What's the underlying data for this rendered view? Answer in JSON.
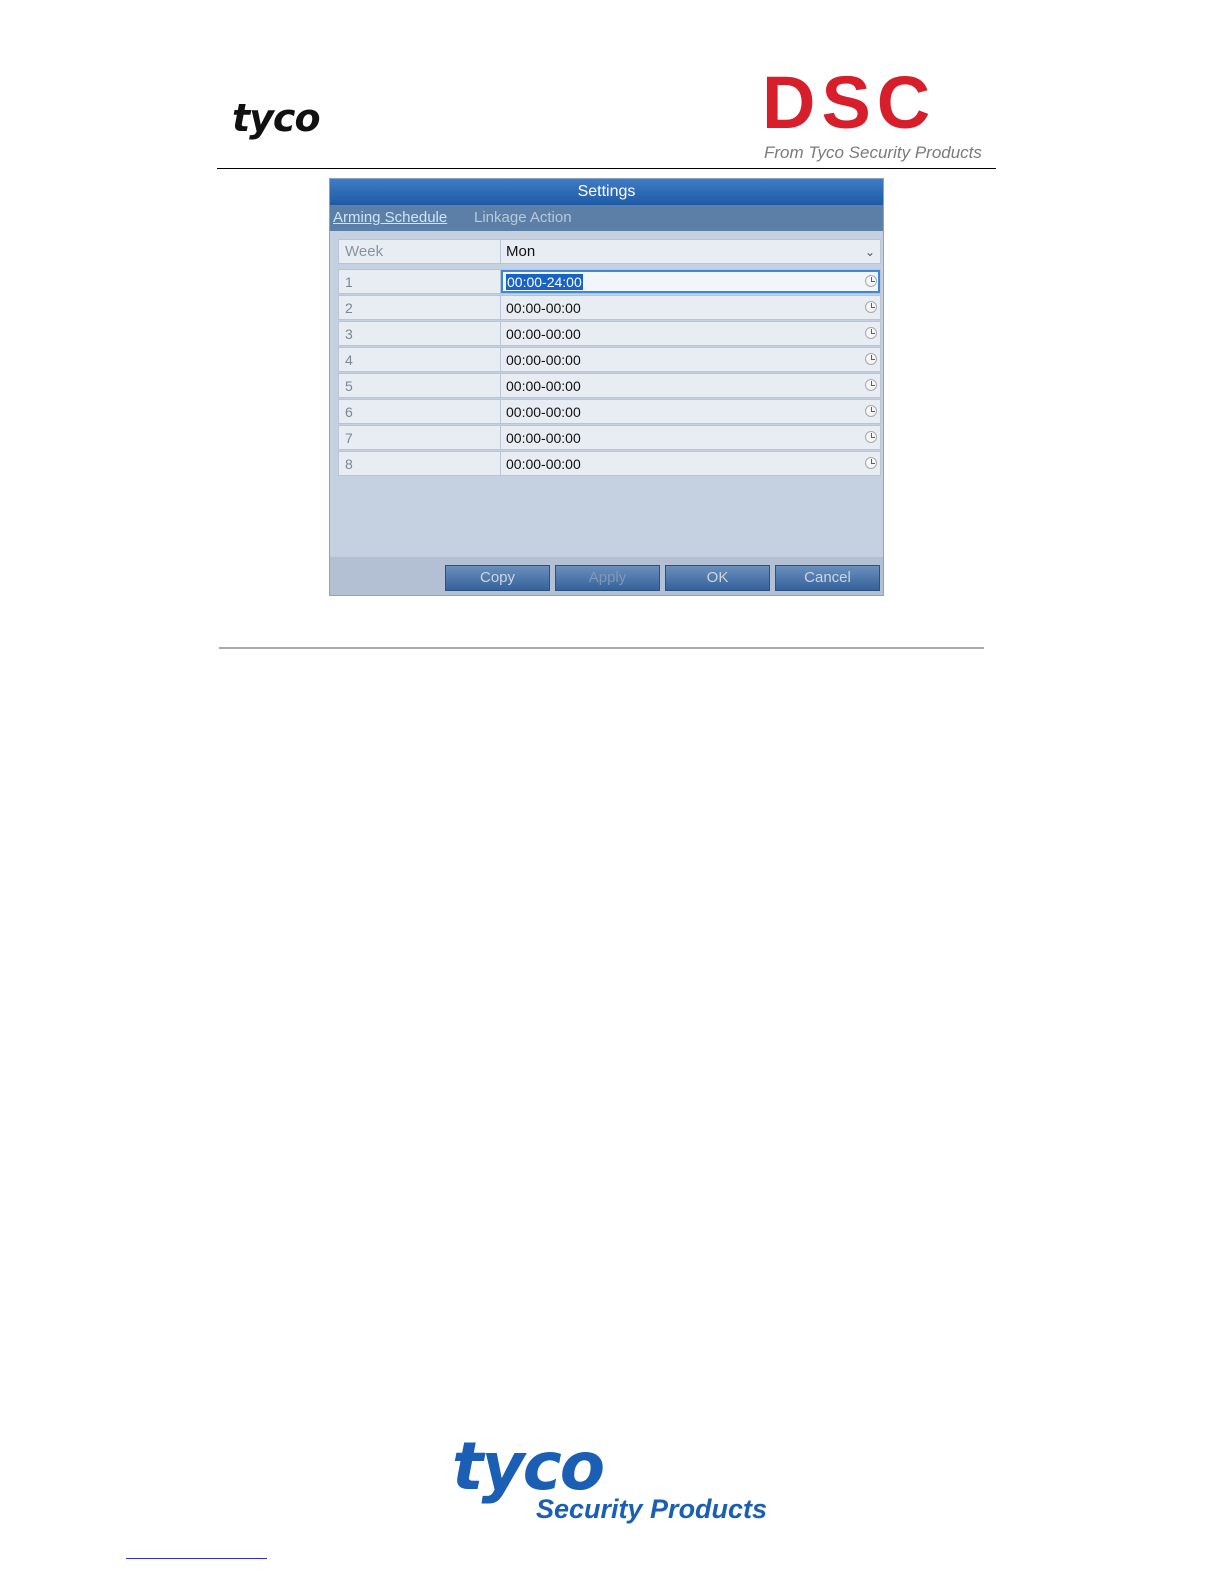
{
  "header": {
    "tyco_logo": "tyco",
    "dsc_logo": "DSC",
    "dsc_tagline": "From Tyco Security Products"
  },
  "dialog": {
    "title": "Settings",
    "tabs": [
      {
        "label": "Arming Schedule",
        "active": true
      },
      {
        "label": "Linkage Action",
        "active": false
      }
    ],
    "week": {
      "label": "Week",
      "value": "Mon"
    },
    "schedule": [
      {
        "index": "1",
        "time": "00:00-24:00",
        "selected": true
      },
      {
        "index": "2",
        "time": "00:00-00:00"
      },
      {
        "index": "3",
        "time": "00:00-00:00"
      },
      {
        "index": "4",
        "time": "00:00-00:00"
      },
      {
        "index": "5",
        "time": "00:00-00:00"
      },
      {
        "index": "6",
        "time": "00:00-00:00"
      },
      {
        "index": "7",
        "time": "00:00-00:00"
      },
      {
        "index": "8",
        "time": "00:00-00:00"
      }
    ],
    "buttons": {
      "copy": "Copy",
      "apply": "Apply",
      "ok": "OK",
      "cancel": "Cancel"
    }
  },
  "footer": {
    "tyco_logo": "tyco",
    "tyco_tagline": "Security Products"
  },
  "colors": {
    "dsc_red": "#d61f2b",
    "tyco_blue": "#1a5fb4",
    "titlebar_blue": "#1f5aa6"
  }
}
